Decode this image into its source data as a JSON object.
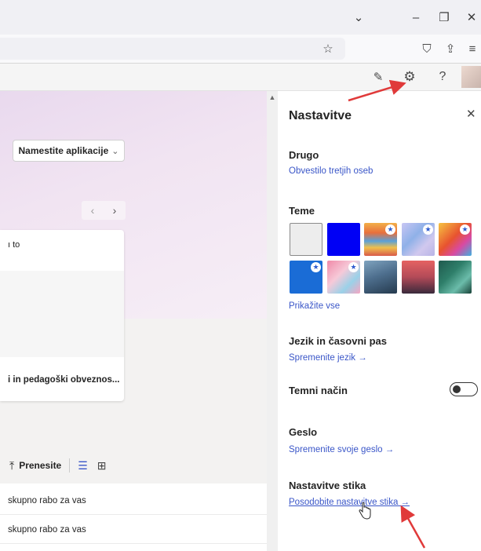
{
  "browser": {
    "minimize_icon": "–",
    "restore_icon": "❐",
    "close_icon": "✕",
    "tabs_dropdown_icon": "⌄",
    "bookmark_icon": "☆",
    "pocket_icon": "⛉",
    "share_icon": "⇪",
    "menu_icon": "≡"
  },
  "app_header": {
    "feedback_icon": "✎",
    "settings_icon": "⚙",
    "help_icon": "?"
  },
  "left": {
    "install_label": "Namestite aplikacije",
    "install_chevron": "⌄",
    "pager_prev": "‹",
    "pager_next": "›",
    "card_top_text": "ı to",
    "card_title": "i in pedagoški obveznos...",
    "upload_icon": "⤒",
    "upload_label": "Prenesite",
    "list_view_icon": "☰",
    "grid_view_icon": "⊞",
    "rows": [
      "skupno rabo za vas",
      "skupno rabo za vas"
    ],
    "scroll_up": "▲"
  },
  "settings": {
    "title": "Nastavitve",
    "close_icon": "✕",
    "other": {
      "heading": "Drugo",
      "link": "Obvestilo tretjih oseb"
    },
    "themes": {
      "heading": "Teme",
      "show_all": "Prikažite vse"
    },
    "language": {
      "heading": "Jezik in časovni pas",
      "link": "Spremenite jezik →"
    },
    "dark_mode": {
      "heading": "Temni način",
      "enabled": false
    },
    "password": {
      "heading": "Geslo",
      "link": "Spremenite svoje geslo →"
    },
    "contact": {
      "heading": "Nastavitve stika",
      "link": "Posodobite nastavitve stika →"
    }
  },
  "colors": {
    "link": "#3a56c8",
    "annotation_arrow": "#e03a3a",
    "selected_theme_border": "#8a8a8a"
  }
}
